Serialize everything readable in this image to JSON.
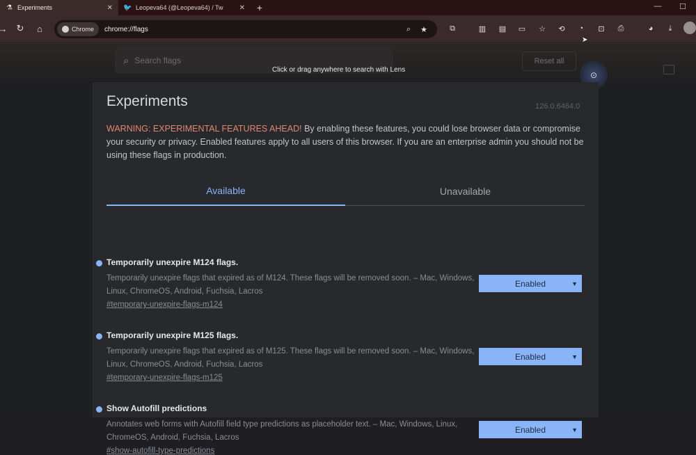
{
  "tabs": [
    {
      "title": "Experiments",
      "active": true
    },
    {
      "title": "Leopeva64 (@Leopeva64) / Tw",
      "active": false
    }
  ],
  "toolbar": {
    "chip_label": "Chrome",
    "url": "chrome://flags"
  },
  "page": {
    "search_placeholder": "Search flags",
    "reset_label": "Reset all",
    "lens_tooltip": "Click or drag anywhere to search with Lens",
    "title": "Experiments",
    "version": "126.0.6464.0",
    "warning_lead": "WARNING: EXPERIMENTAL FEATURES AHEAD!",
    "warning_body": " By enabling these features, you could lose browser data or compromise your security or privacy. Enabled features apply to all users of this browser. If you are an enterprise admin you should not be using these flags in production.",
    "tab_available": "Available",
    "tab_unavailable": "Unavailable"
  },
  "flags": [
    {
      "name": "Temporarily unexpire M124 flags.",
      "description": "Temporarily unexpire flags that expired as of M124. These flags will be removed soon. – Mac, Windows, Linux, ChromeOS, Android, Fuchsia, Lacros",
      "link": "#temporary-unexpire-flags-m124",
      "value": "Enabled"
    },
    {
      "name": "Temporarily unexpire M125 flags.",
      "description": "Temporarily unexpire flags that expired as of M125. These flags will be removed soon. – Mac, Windows, Linux, ChromeOS, Android, Fuchsia, Lacros",
      "link": "#temporary-unexpire-flags-m125",
      "value": "Enabled"
    },
    {
      "name": "Show Autofill predictions",
      "description": "Annotates web forms with Autofill field type predictions as placeholder text. – Mac, Windows, Linux, ChromeOS, Android, Fuchsia, Lacros",
      "link": "#show-autofill-type-predictions",
      "value": "Enabled"
    }
  ],
  "colors": {
    "accent": "#8ab4f8",
    "warning": "#e2876f"
  }
}
